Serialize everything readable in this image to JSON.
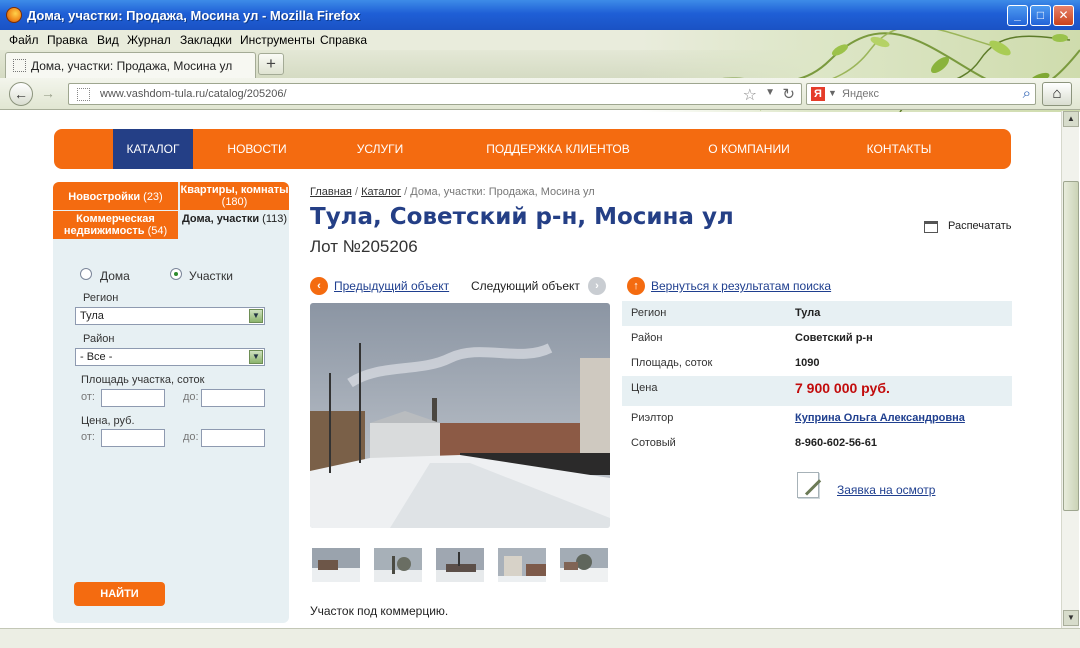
{
  "window": {
    "title": "Дома, участки: Продажа, Мосина ул - Mozilla Firefox"
  },
  "menu": [
    "Файл",
    "Правка",
    "Вид",
    "Журнал",
    "Закладки",
    "Инструменты",
    "Справка"
  ],
  "tab": {
    "label": "Дома, участки: Продажа, Мосина ул",
    "new_tab": "+"
  },
  "address": {
    "url": "www.vashdom-tula.ru/catalog/205206/"
  },
  "search": {
    "engine_letter": "Я",
    "placeholder": "Яндекс"
  },
  "topnav": [
    "КАТАЛОГ",
    "НОВОСТИ",
    "УСЛУГИ",
    "ПОДДЕРЖКА КЛИЕНТОВ",
    "О КОМПАНИИ",
    "КОНТАКТЫ"
  ],
  "sidebar": {
    "tabs": [
      {
        "label": "Новостройки",
        "count": "(23)"
      },
      {
        "label": "Квартиры, комнаты",
        "count": "(180)"
      },
      {
        "label": "Коммерческая недвижимость",
        "count": "(54)"
      },
      {
        "label": "Дома, участки",
        "count": "(113)"
      }
    ],
    "radio_houses": "Дома",
    "radio_plots": "Участки",
    "region_label": "Регион",
    "region_value": "Тула",
    "district_label": "Район",
    "district_value": "- Все -",
    "area_label": "Площадь участка, соток",
    "price_label": "Цена, руб.",
    "from": "от:",
    "to": "до:",
    "find_button": "НАЙТИ"
  },
  "breadcrumb": {
    "home": "Главная",
    "sep": "/",
    "catalog": "Каталог",
    "current": "Дома, участки: Продажа, Мосина ул"
  },
  "title": "Тула, Советский р-н, Мосина ул",
  "lot": "Лот №205206",
  "print_label": "Распечатать",
  "nav_prev": "Предыдущий объект",
  "nav_next": "Следующий объект",
  "back_to_results": "Вернуться к результатам поиска",
  "properties": [
    {
      "key": "Регион",
      "value": "Тула"
    },
    {
      "key": "Район",
      "value": "Советский р-н"
    },
    {
      "key": "Площадь, соток",
      "value": "1090"
    },
    {
      "key": "Цена",
      "value": "7 900 000 руб."
    },
    {
      "key": "Риэлтор",
      "value": "Куприна Ольга Александровна"
    },
    {
      "key": "Сотовый",
      "value": "8-960-602-56-61"
    }
  ],
  "request_label": "Заявка на осмотр",
  "description": "Участок под коммерцию.",
  "colors": {
    "orange": "#f46b10",
    "navy": "#243f86",
    "price_red": "#c20c0c",
    "panel": "#e7f0f3"
  }
}
